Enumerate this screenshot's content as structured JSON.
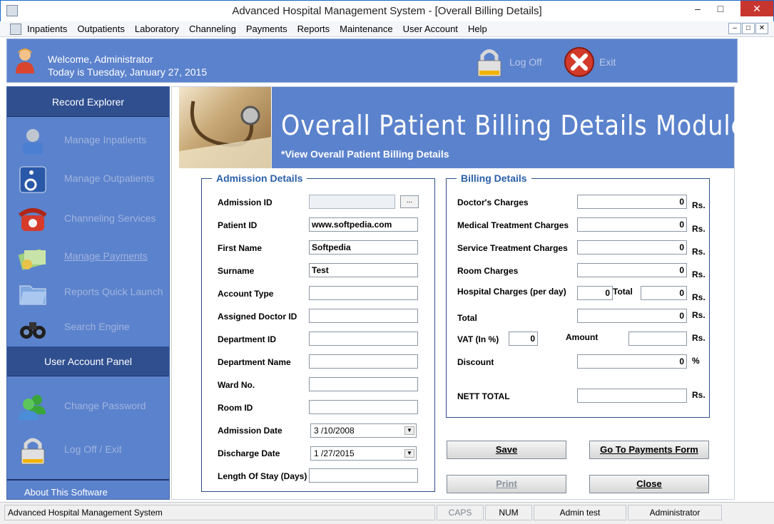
{
  "window": {
    "title": "Advanced Hospital Management System - [Overall Billing Details]",
    "min": "–",
    "max": "□",
    "close": "✕"
  },
  "menu": [
    "Inpatients",
    "Outpatients",
    "Laboratory",
    "Channeling",
    "Payments",
    "Reports",
    "Maintenance",
    "User Account",
    "Help"
  ],
  "header": {
    "welcome": "Welcome, Administrator",
    "date": "Today is Tuesday, January 27, 2015",
    "logoff": "Log Off",
    "exit": "Exit"
  },
  "sidebar": {
    "record_title": "Record Explorer",
    "items": [
      "Manage Inpatients",
      "Manage Outpatients",
      "Channeling Services",
      "Manage Payments",
      "Reports Quick Launch",
      "Search Engine"
    ],
    "user_title": "User Account Panel",
    "user_items": [
      "Change Password",
      "Log Off / Exit"
    ],
    "about": "About This Software"
  },
  "banner": {
    "title": "Overall Patient Billing Details Module",
    "subtitle": "*View Overall Patient Billing Details"
  },
  "admission": {
    "legend": "Admission Details",
    "browse": "...",
    "fields": [
      {
        "label": "Admission ID",
        "value": ""
      },
      {
        "label": "Patient ID",
        "value": "www.softpedia.com"
      },
      {
        "label": "First Name",
        "value": "Softpedia"
      },
      {
        "label": "Surname",
        "value": "Test"
      },
      {
        "label": "Account Type",
        "value": ""
      },
      {
        "label": "Assigned Doctor ID",
        "value": ""
      },
      {
        "label": "Department ID",
        "value": ""
      },
      {
        "label": "Department Name",
        "value": ""
      },
      {
        "label": "Ward No.",
        "value": ""
      },
      {
        "label": "Room ID",
        "value": ""
      }
    ],
    "admission_date_label": "Admission Date",
    "admission_date": "3 /10/2008",
    "discharge_date_label": "Discharge Date",
    "discharge_date": "1 /27/2015",
    "stay_label": "Length Of Stay (Days)",
    "stay_value": ""
  },
  "billing": {
    "legend": "Billing Details",
    "currency": "Rs.",
    "percent": "%",
    "doctor_label": "Doctor's Charges",
    "doctor": "0",
    "medical_label": "Medical Treatment Charges",
    "medical": "0",
    "service_label": "Service Treatment Charges",
    "service": "0",
    "room_label": "Room Charges",
    "room": "0",
    "hospital_label": "Hospital Charges (per day)",
    "hospital_per_day": "0",
    "hospital_total_label": "Total",
    "hospital_total": "0",
    "total_label": "Total",
    "total": "0",
    "vat_label": "VAT (In %)",
    "vat": "0",
    "amount_label": "Amount",
    "amount": "",
    "discount_label": "Discount",
    "discount": "0",
    "nett_label": "NETT TOTAL",
    "nett": ""
  },
  "buttons": {
    "save": "Save",
    "goto": "Go To Payments Form",
    "print": "Print",
    "close": "Close"
  },
  "status": {
    "app": "Advanced Hospital Management System",
    "caps": "CAPS",
    "num": "NUM",
    "user": "Admin test",
    "role": "Administrator"
  },
  "colors": {
    "panel_blue": "#5b82cc",
    "panel_dark": "#2f4f8f",
    "legend_blue": "#2a5fa8"
  }
}
